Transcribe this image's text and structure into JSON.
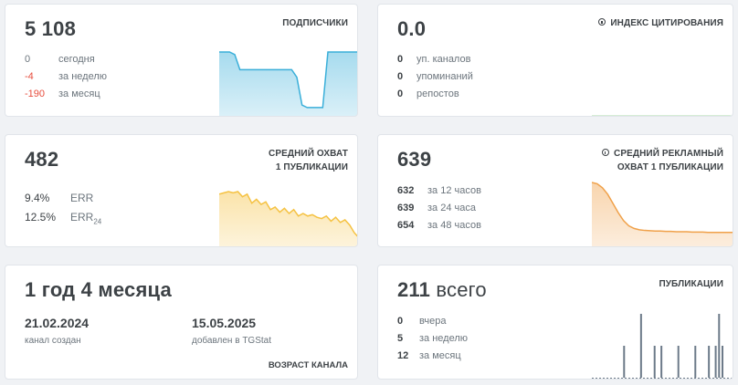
{
  "subscribers": {
    "value": "5 108",
    "title": "ПОДПИСЧИКИ",
    "stats": [
      {
        "value": "0",
        "label": "сегодня",
        "tone": "neutral"
      },
      {
        "value": "-4",
        "label": "за неделю",
        "tone": "negative"
      },
      {
        "value": "-190",
        "label": "за месяц",
        "tone": "negative"
      }
    ],
    "color": "#3aafd9",
    "chart_data": {
      "type": "area",
      "y": [
        98,
        98,
        98,
        97,
        91,
        91,
        91,
        91,
        91,
        91,
        91,
        91,
        91,
        91,
        91,
        88,
        77,
        76,
        76,
        76,
        76,
        98,
        98,
        98,
        98,
        98,
        98,
        98
      ]
    }
  },
  "citation": {
    "value": "0.0",
    "title": "ИНДЕКС ЦИТИРОВАНИЯ",
    "info_icon": "info-icon",
    "stats": [
      {
        "value": "0",
        "label": "уп. каналов"
      },
      {
        "value": "0",
        "label": "упоминаний"
      },
      {
        "value": "0",
        "label": "репостов"
      }
    ],
    "color": "#5cb85c",
    "chart_data": {
      "type": "line",
      "y": [
        0,
        0
      ]
    }
  },
  "reach": {
    "value": "482",
    "title_line1": "СРЕДНИЙ ОХВАТ",
    "title_line2": "1 ПУБЛИКАЦИИ",
    "stats": [
      {
        "value": "9.4%",
        "label": "ERR",
        "sub": ""
      },
      {
        "value": "12.5%",
        "label": "ERR",
        "sub": "24"
      }
    ],
    "color": "#f5c242",
    "chart_data": {
      "type": "area",
      "y": [
        62,
        63,
        64,
        63,
        64,
        60,
        62,
        55,
        58,
        54,
        56,
        50,
        52,
        48,
        51,
        47,
        50,
        45,
        47,
        45,
        46,
        44,
        43,
        45,
        41,
        44,
        40,
        42,
        38,
        32,
        28
      ]
    }
  },
  "ad_reach": {
    "value": "639",
    "title_line1": "СРЕДНИЙ РЕКЛАМНЫЙ",
    "title_line2": "ОХВАТ 1 ПУБЛИКАЦИИ",
    "info_icon": "info-icon",
    "stats": [
      {
        "value": "632",
        "label": "за 12 часов"
      },
      {
        "value": "639",
        "label": "за 24 часа"
      },
      {
        "value": "654",
        "label": "за 48 часов"
      }
    ],
    "color": "#f0a14a",
    "chart_data": {
      "type": "area",
      "y": [
        100,
        98,
        92,
        82,
        68,
        54,
        42,
        34,
        30,
        28,
        27,
        26.5,
        26,
        26,
        25.5,
        25.5,
        25,
        25,
        25,
        24.5,
        24.5,
        24.5,
        24,
        24,
        24,
        24,
        24,
        24
      ]
    }
  },
  "age": {
    "value": "1 год 4 месяца",
    "created_date": "21.02.2024",
    "created_label": "канал создан",
    "added_date": "15.05.2025",
    "added_label": "добавлен в TGStat",
    "label": "ВОЗРАСТ КАНАЛА"
  },
  "publications": {
    "value": "211",
    "value_suffix": "всего",
    "title": "ПУБЛИКАЦИИ",
    "stats": [
      {
        "value": "0",
        "label": "вчера"
      },
      {
        "value": "5",
        "label": "за неделю"
      },
      {
        "value": "12",
        "label": "за месяц"
      }
    ],
    "color": "#6c7a89",
    "chart_data": {
      "type": "bar",
      "values": [
        0,
        0,
        0,
        0,
        0,
        0,
        0,
        0,
        0,
        1,
        0,
        0,
        0,
        0,
        2,
        0,
        0,
        0,
        1,
        0,
        1,
        0,
        0,
        0,
        0,
        1,
        0,
        0,
        0,
        0,
        1,
        0,
        0,
        0,
        1,
        0,
        1,
        2,
        1,
        0,
        0,
        0
      ]
    }
  }
}
